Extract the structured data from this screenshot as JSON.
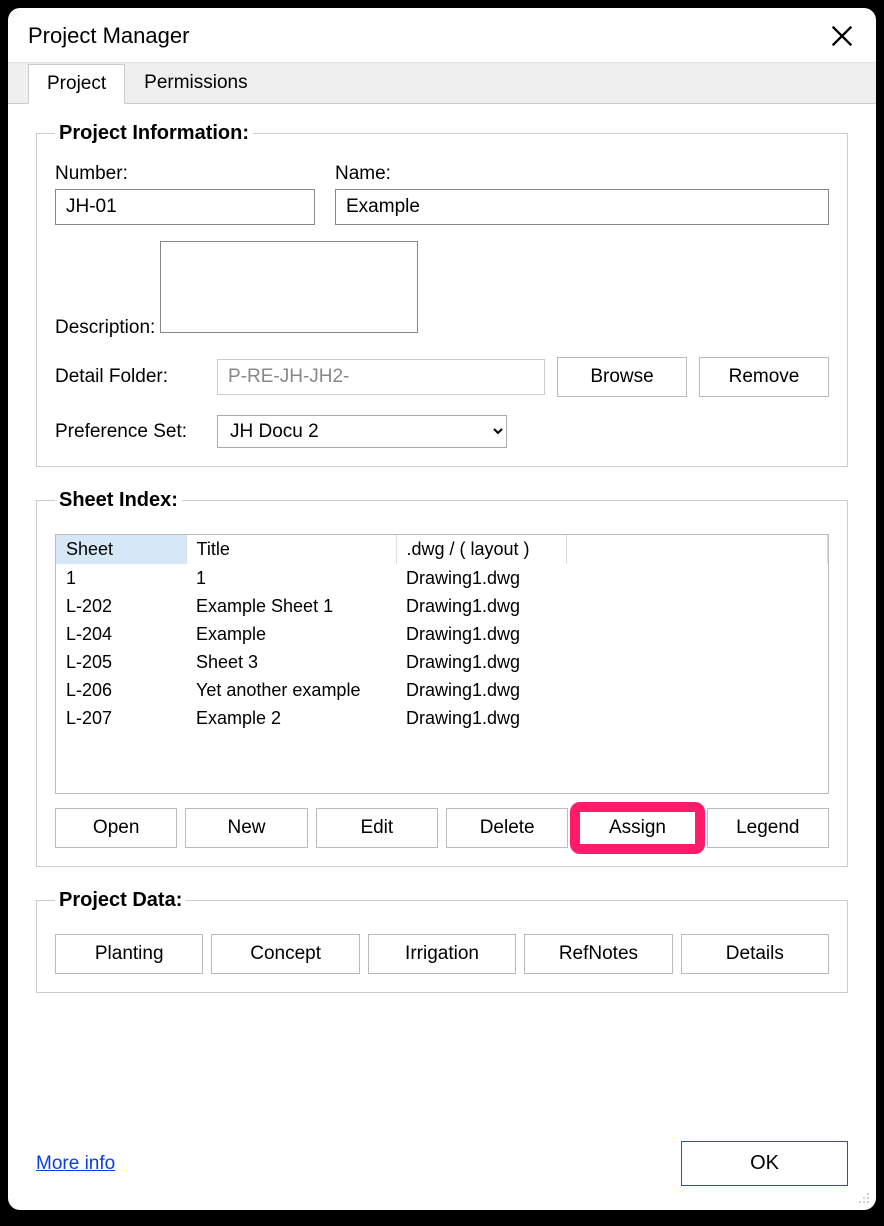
{
  "window": {
    "title": "Project Manager"
  },
  "tabs": {
    "project": "Project",
    "permissions": "Permissions"
  },
  "projectInfo": {
    "legend": "Project Information:",
    "numberLabel": "Number:",
    "numberValue": "JH-01",
    "nameLabel": "Name:",
    "nameValue": "Example",
    "descLabel": "Description:",
    "descValue": "",
    "detailFolderLabel": "Detail Folder:",
    "detailFolderValue": "P-RE-JH-JH2-",
    "browse": "Browse",
    "remove": "Remove",
    "prefSetLabel": "Preference Set:",
    "prefSetValue": "JH Docu 2"
  },
  "sheetIndex": {
    "legend": "Sheet Index:",
    "headers": {
      "sheet": "Sheet",
      "title": "Title",
      "dwg": ".dwg / ( layout )"
    },
    "rows": [
      {
        "sheet": "1",
        "title": "1",
        "dwg": "Drawing1.dwg"
      },
      {
        "sheet": "L-202",
        "title": "Example Sheet 1",
        "dwg": "Drawing1.dwg"
      },
      {
        "sheet": "L-204",
        "title": "Example",
        "dwg": "Drawing1.dwg"
      },
      {
        "sheet": "L-205",
        "title": "Sheet 3",
        "dwg": "Drawing1.dwg"
      },
      {
        "sheet": "L-206",
        "title": "Yet another example",
        "dwg": "Drawing1.dwg"
      },
      {
        "sheet": "L-207",
        "title": "Example 2",
        "dwg": "Drawing1.dwg"
      }
    ],
    "buttons": {
      "open": "Open",
      "new": "New",
      "edit": "Edit",
      "delete": "Delete",
      "assign": "Assign",
      "legend": "Legend"
    }
  },
  "projectData": {
    "legend": "Project Data:",
    "buttons": {
      "planting": "Planting",
      "concept": "Concept",
      "irrigation": "Irrigation",
      "refnotes": "RefNotes",
      "details": "Details"
    }
  },
  "footer": {
    "moreInfo": "More info",
    "ok": "OK"
  }
}
